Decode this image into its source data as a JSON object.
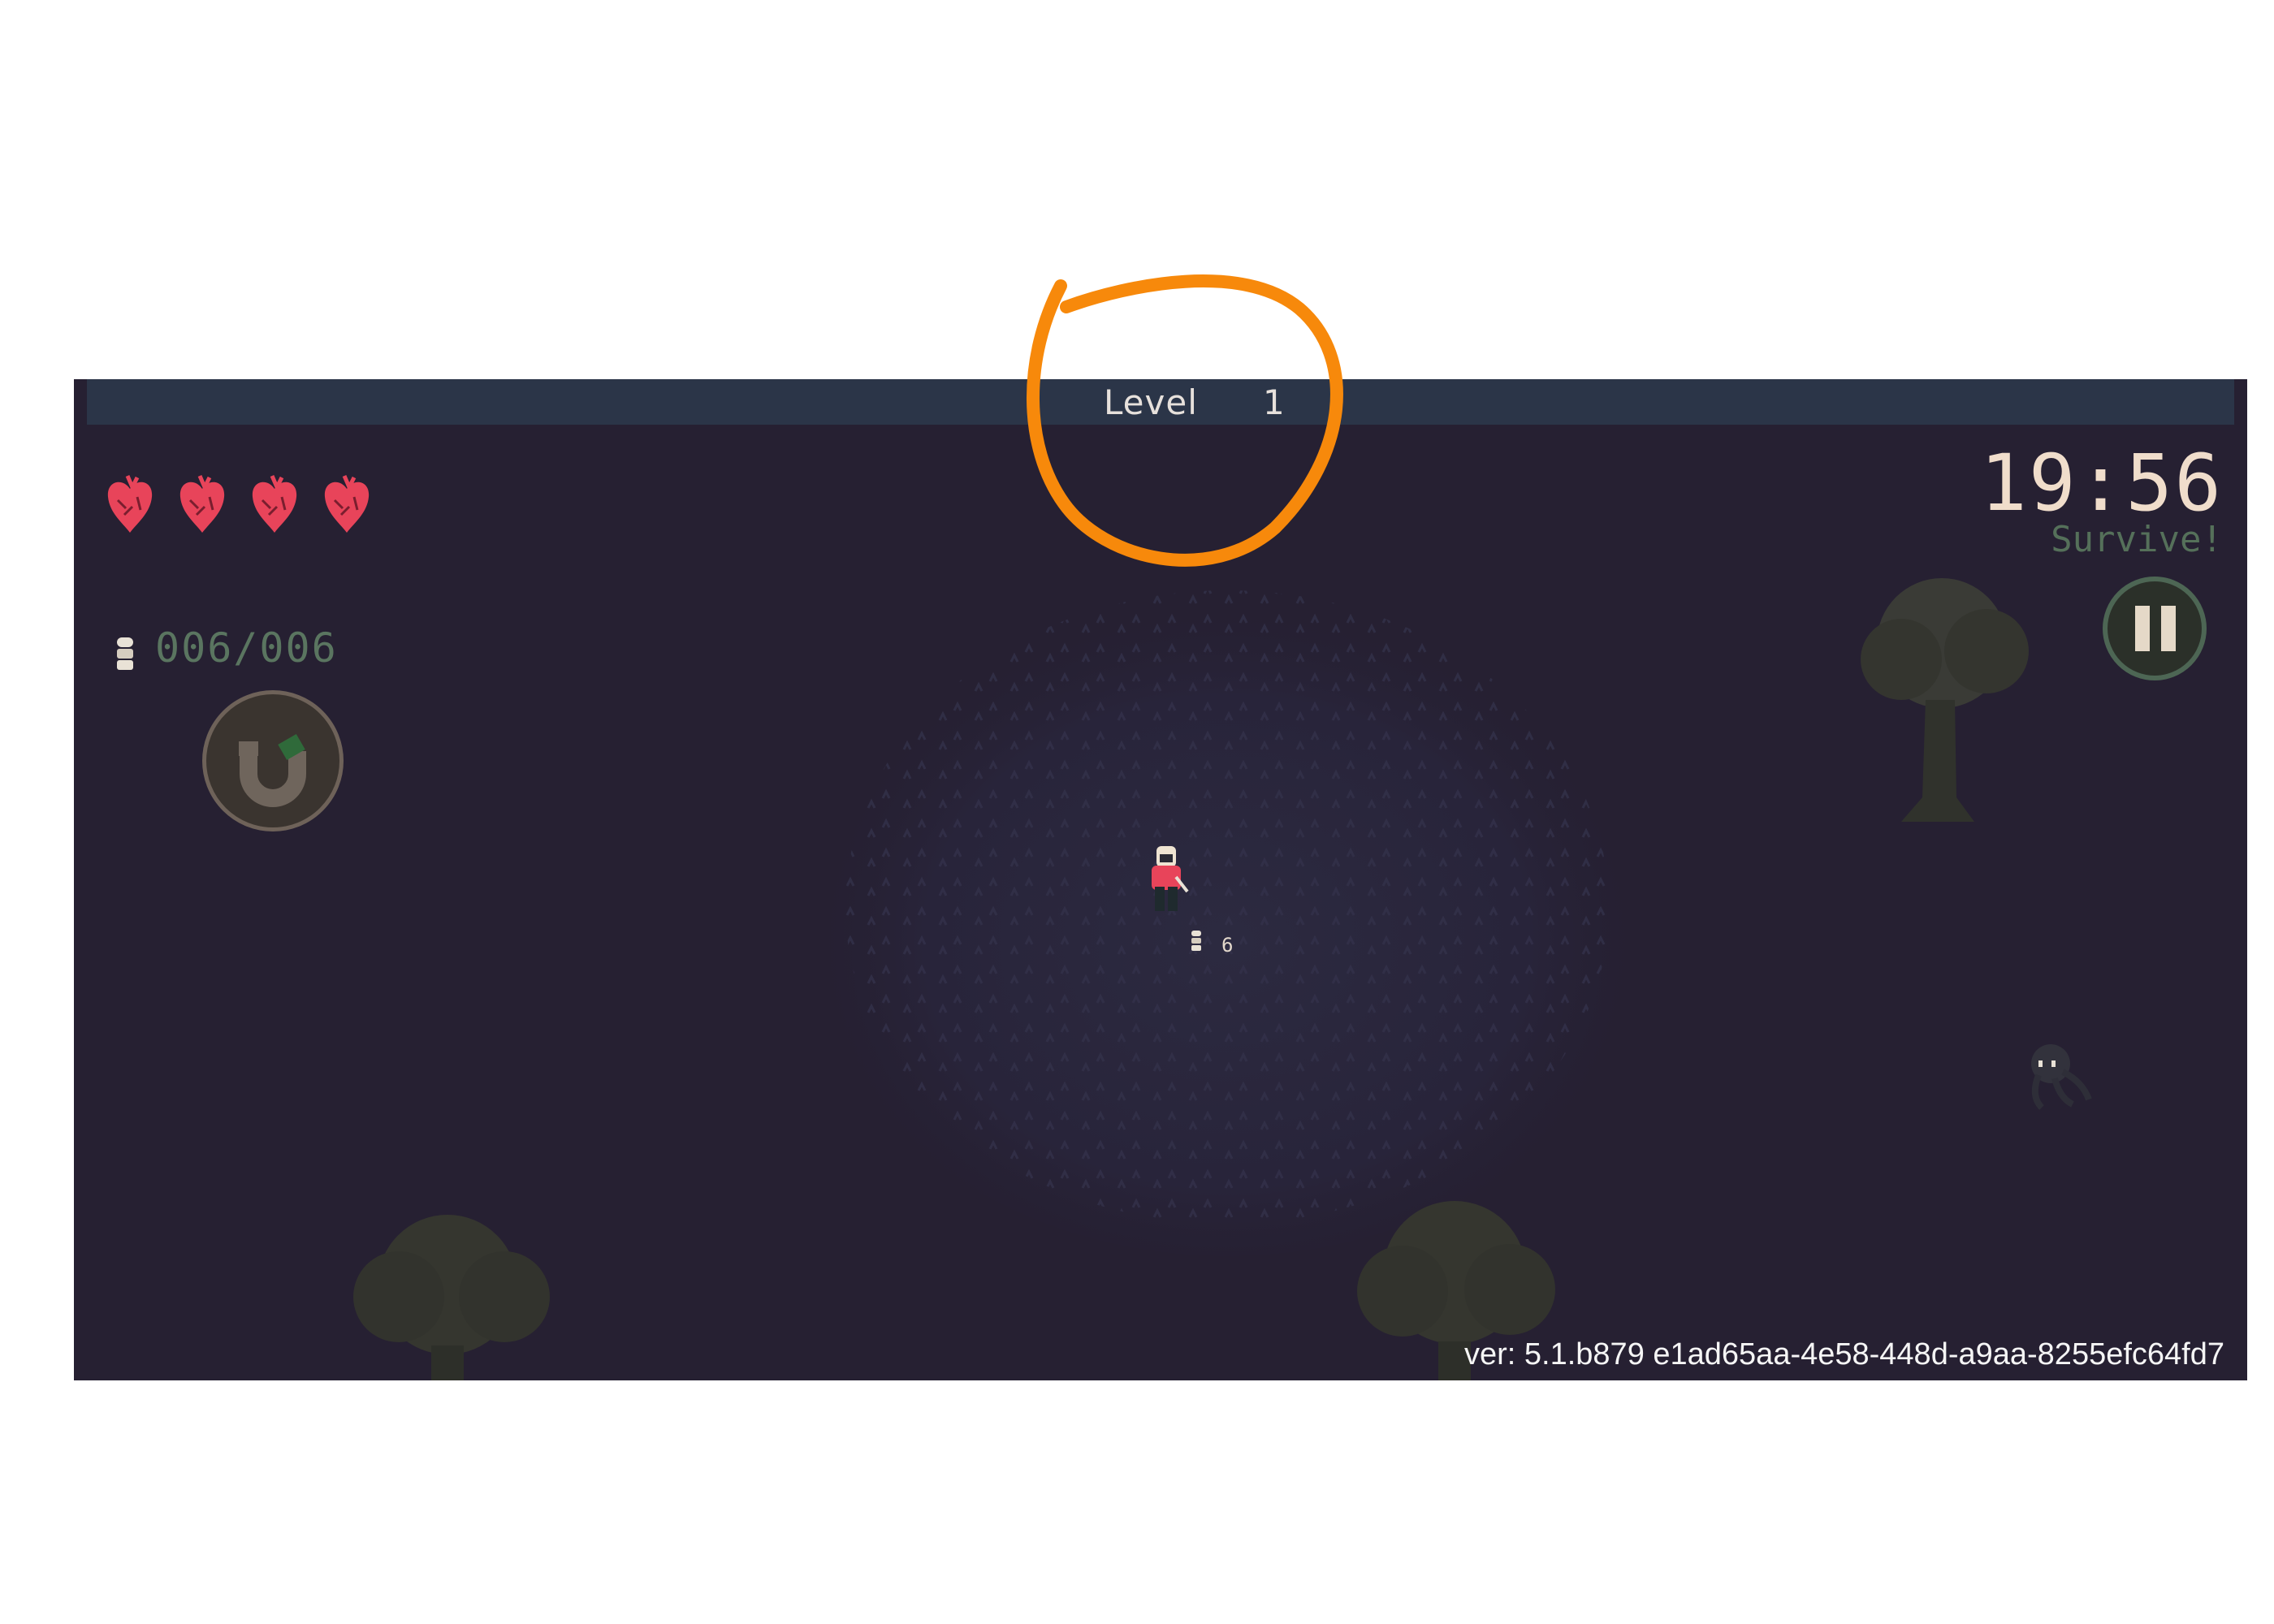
{
  "hud": {
    "level_label": "Level",
    "level_value": "1",
    "hearts": [
      "heart-1",
      "heart-2",
      "heart-3",
      "heart-4"
    ],
    "ammo_count": "006/006",
    "timer": "19:56",
    "objective": "Survive!",
    "magnet_icon": "magnet-icon",
    "pause_icon": "pause-icon"
  },
  "world": {
    "pickup_count": "6"
  },
  "footer": {
    "version": "ver: 5.1.b879 e1ad65aa-4e58-448d-a9aa-8255efc64fd7"
  },
  "colors": {
    "background": "#262032",
    "xp_bar": "#2b3548",
    "heart": "#e8445a",
    "timer": "#f0ddcb",
    "objective": "#55705a",
    "annotation": "#f7890b"
  }
}
